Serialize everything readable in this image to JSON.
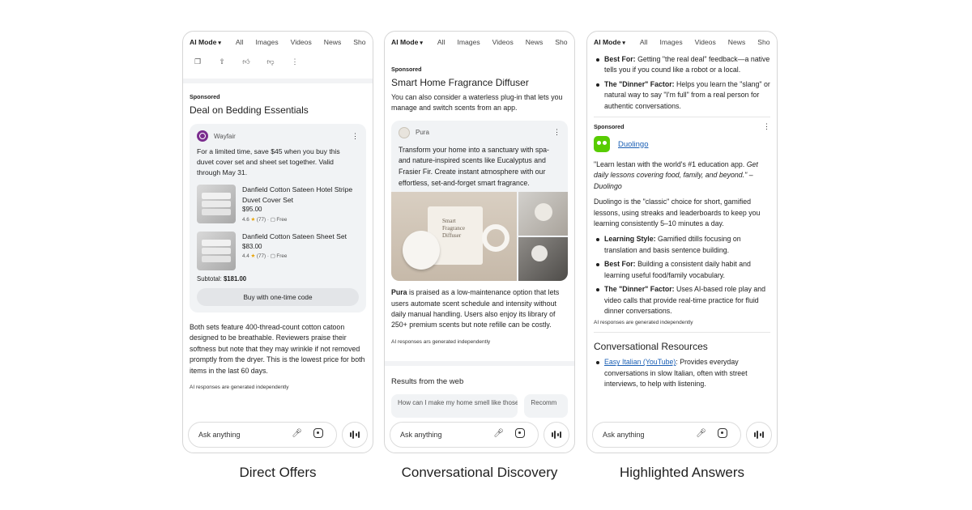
{
  "tabs": {
    "mode": "AI Mode",
    "items": [
      "All",
      "Images",
      "Videos",
      "News",
      "Sho"
    ]
  },
  "ask_placeholder": "Ask anything",
  "ai_disclaimer": "AI responses are generated independently",
  "ai_disclaimer_alt": "AI responses ars generated independently",
  "sponsored_label": "Sponsored",
  "icons": {
    "copy": "copy-icon",
    "share": "share-icon",
    "thumbs_up": "thumbs-up-icon",
    "thumbs_down": "thumbs-down-icon",
    "more": "more-vert-icon",
    "mic": "mic-icon",
    "lens": "lens-icon",
    "voice": "voice-mode-icon"
  },
  "panel1": {
    "caption": "Direct Offers",
    "title": "Deal on Bedding Essentials",
    "advertiser": "Wayfair",
    "offer_text": "For a limited time, save $45 when you buy this duvet cover set and sheet set together. Valid through May 31.",
    "products": [
      {
        "name": "Danfield Cotton Sateen Hotel Stripe Duvet Cover Set",
        "price": "$95.00",
        "rating": "4.6",
        "reviews": "(77)",
        "shipping": "Free"
      },
      {
        "name": "Danfield Cotton Sateen Sheet Set",
        "price": "$83.00",
        "rating": "4.4",
        "reviews": "(77)",
        "shipping": "Free"
      }
    ],
    "subtotal_label": "Subtotal:",
    "subtotal_value": "$181.00",
    "buy_button": "Buy with one-time code",
    "summary": "Both sets feature 400-thread-count cotton catoon designed to be breathable. Reviewers praise their softness but note that they may wrinkle if not removed promptly from the dryer. This is the lowest price for both items in the last 60 days."
  },
  "panel2": {
    "caption": "Conversational Discovery",
    "title": "Smart Home Fragrance Diffuser",
    "intro": "You can also consider a waterless plug-in that lets you manage and switch scents from an app.",
    "advertiser": "Pura",
    "ad_text": "Transform your home into a sanctuary with spa- and nature-inspired scents like Eucalyptus and Frasier Fir. Create instant atmosphere with our effortless, set-and-forget smart fragrance.",
    "box_label_1": "Smart",
    "box_label_2": "Fragrance",
    "box_label_3": "Diffuser",
    "summary_bold": "Pura",
    "summary_rest": " is praised as a low-maintenance option that lets users automate scent schedule and intensity without daily manual handling. Users also enjoy its library of 250+ premium scents but note refille can be costly.",
    "web_results_heading": "Results from the web",
    "web_chips": [
      "How can I make my home smell like those",
      "Recomm"
    ]
  },
  "panel3": {
    "caption": "Highlighted Answers",
    "top_bullets": [
      {
        "bold": "Best For:",
        "text": " Getting \"the real deal\" feedback—a native tells you if you cound like a robot or a local."
      },
      {
        "bold": "The \"Dinner\" Factor:",
        "text": " Helps you learn the \"slang\" or natural way to say \"I'm full\" from a real person for authentic conversations."
      }
    ],
    "advertiser": "Duolingo",
    "quote_line": "\"Learn lestan with the world's #1 education app.",
    "quote_italic": "Get daily lessons covering food, family, and beyond.\" –Duolingo",
    "description": "Duolingo is the \"classic\" choice for short, gamified lessons, using streaks and leaderboards to keep you learning consistently 5–10 minutes a day.",
    "bullets": [
      {
        "bold": "Learning Style:",
        "text": " Gamified dtills focusing on translation and basis sentence building."
      },
      {
        "bold": "Best For:",
        "text": " Building a consistent daily habit and learning useful food/family vocabulary."
      },
      {
        "bold": "The \"Dinner\" Factor:",
        "text": " Uses AI-based role play and video calls that provide real-time practice for fluid dinner conversations."
      }
    ],
    "resources_heading": "Conversational Resources",
    "resource_link": "Easy Italian (YouTube)",
    "resource_text": ": Provides everyday conversations in slow Italian, often with street interviews, to help with listening."
  },
  "colors": {
    "wayfair": "#7b2d8e",
    "duolingo": "#58cc02",
    "link": "#1a5fb4"
  }
}
